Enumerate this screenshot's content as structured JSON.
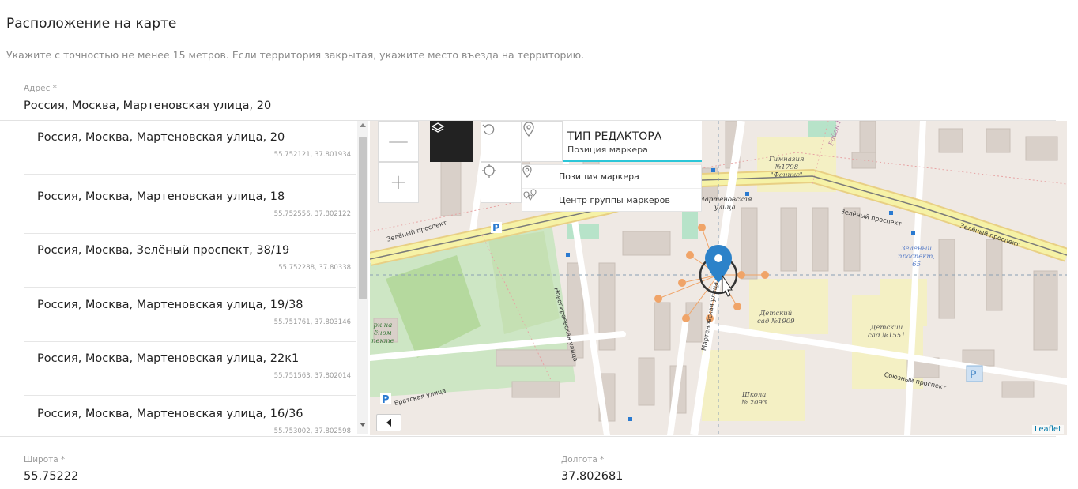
{
  "section": {
    "title": "Расположение на карте",
    "hint": "Укажите с точностью не менее 15 метров. Если территория закрытая, укажите место въезда на территорию."
  },
  "address": {
    "label": "Адрес *",
    "value": "Россия, Москва, Мартеновская улица, 20"
  },
  "suggestions": [
    {
      "address": "Россия, Москва, Мартеновская улица, 20",
      "coords": "55.752121, 37.801934"
    },
    {
      "address": "Россия, Москва, Мартеновская улица, 18",
      "coords": "55.752556, 37.802122"
    },
    {
      "address": "Россия, Москва, Зелёный проспект, 38/19",
      "coords": "55.752288, 37.80338"
    },
    {
      "address": "Россия, Москва, Мартеновская улица, 19/38",
      "coords": "55.751761, 37.803146"
    },
    {
      "address": "Россия, Москва, Мартеновская улица, 22к1",
      "coords": "55.751563, 37.802014"
    },
    {
      "address": "Россия, Москва, Мартеновская улица, 16/36",
      "coords": "55.753002, 37.802598"
    }
  ],
  "map": {
    "zoom_out": "—",
    "zoom_in": "+",
    "editor": {
      "title": "ТИП РЕДАКТОРА",
      "subtitle": "Позиция маркера"
    },
    "menu": [
      {
        "label": "Позиция маркера",
        "icon": "marker-icon"
      },
      {
        "label": "Центр группы маркеров",
        "icon": "marker-group-icon"
      }
    ],
    "attribution": "Leaflet",
    "labels": {
      "gymnasium": "Гимназия\n№1798\n\"Феникс\"",
      "district": "Район Перово",
      "martenovskaya_top": "Мартеновская\nулица",
      "zeleny_65": "Зеленый\nпроспект,\n65",
      "kindergarten_1909": "Детский\nсад №1909",
      "kindergarten_1551": "Детский\nсад №1551",
      "school_2093": "Школа\n№ 2093",
      "park": "рк на\nёном\nпекте"
    },
    "streets": {
      "zeleny_left": "Зелёный проспект",
      "zeleny_right1": "Зелёный проспект",
      "zeleny_right2": "Зелёный проспект",
      "novogireevskaya": "Новогиреевская улица",
      "martenovskaya": "Мартеновская улица",
      "bratskaya": "Братская улица",
      "soyuzny": "Союзный проспект"
    }
  },
  "latitude": {
    "label": "Широта *",
    "value": "55.75222"
  },
  "longitude": {
    "label": "Долгота *",
    "value": "37.802681"
  },
  "colors": {
    "accent": "#2cc6d8",
    "marker": "#2c82c9",
    "cluster": "#f0a468",
    "road_major": "#f6f2a6"
  }
}
